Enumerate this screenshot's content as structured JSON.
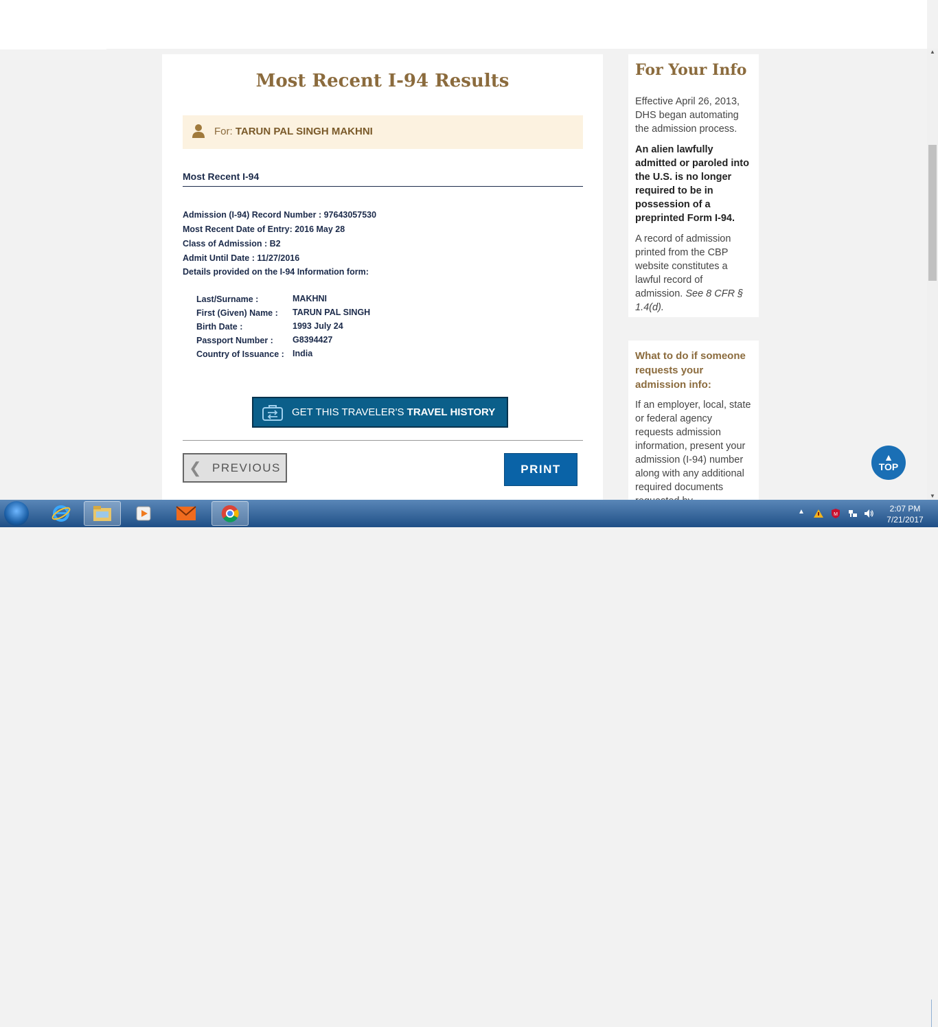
{
  "main": {
    "title": "Most Recent I-94 Results",
    "for_label": "For:",
    "for_name": "TARUN PAL SINGH MAKHNI",
    "section_title": "Most Recent I-94",
    "info_lines": [
      "Admission (I-94) Record Number : 97643057530",
      "Most Recent Date of Entry: 2016 May 28",
      "Class of Admission : B2",
      "Admit Until Date : 11/27/2016",
      "Details provided on the I-94 Information form:"
    ],
    "details": [
      {
        "label": "Last/Surname :",
        "value": "MAKHNI"
      },
      {
        "label": "First (Given) Name :",
        "value": "TARUN PAL SINGH"
      },
      {
        "label": "Birth Date :",
        "value": "1993 July 24"
      },
      {
        "label": "Passport Number :",
        "value": "G8394427"
      },
      {
        "label": "Country of Issuance :",
        "value": "India"
      }
    ],
    "travel_button_prefix": "GET THIS TRAVELER'S",
    "travel_button_bold": "TRAVEL HISTORY",
    "previous_label": "PREVIOUS",
    "print_label": "PRINT"
  },
  "sidebar": {
    "title": "For Your Info",
    "para1": "Effective April 26, 2013, DHS began automating the admission process.",
    "para2": "An alien lawfully admitted or paroled into the U.S. is no longer required to be in possession of a preprinted Form I-94.",
    "para3_text": "A record of admission printed from the CBP website constitutes a lawful record of admission.",
    "para3_cite": "See 8 CFR § 1.4(d).",
    "heading": "What to do if someone requests your admission info:",
    "para4": "If an employer, local, state or federal agency requests admission information, present your admission (I-94) number along with any additional required documents requested by"
  },
  "top_button": {
    "label": "TOP"
  },
  "taskbar": {
    "apps": [
      "internet-explorer",
      "file-explorer",
      "media-player",
      "mail",
      "chrome"
    ],
    "clock_time": "2:07 PM",
    "clock_date": "7/21/2017"
  }
}
